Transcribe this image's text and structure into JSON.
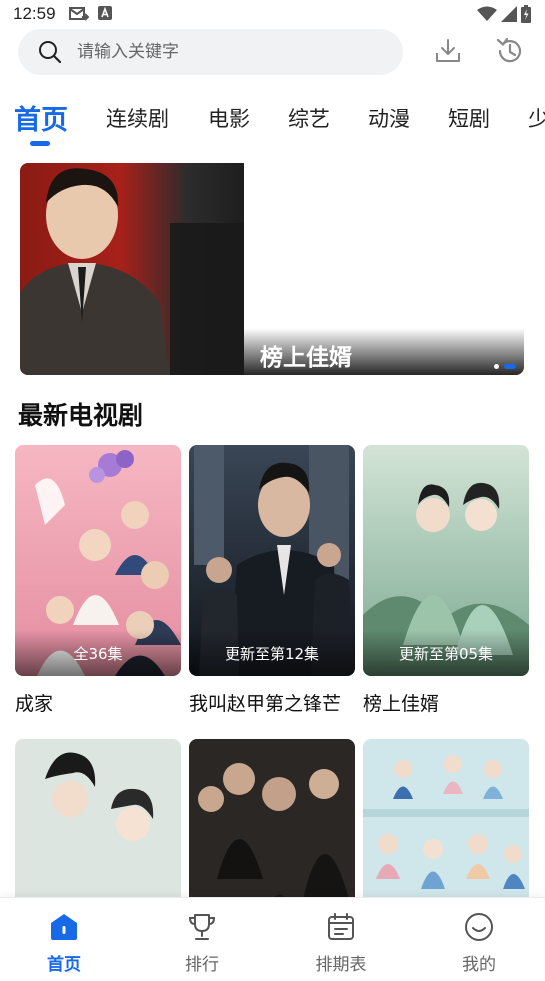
{
  "status_bar": {
    "time": "12:59",
    "left_icons": [
      "mail-forward-icon",
      "a-box-icon"
    ],
    "right_icons": [
      "wifi-icon",
      "signal-icon",
      "battery-icon"
    ]
  },
  "search": {
    "placeholder": "请输入关键字"
  },
  "header_icons": [
    "download-icon",
    "history-icon"
  ],
  "tabs": [
    {
      "label": "首页",
      "active": true
    },
    {
      "label": "连续剧",
      "active": false
    },
    {
      "label": "电影",
      "active": false
    },
    {
      "label": "综艺",
      "active": false
    },
    {
      "label": "动漫",
      "active": false
    },
    {
      "label": "短剧",
      "active": false
    },
    {
      "label": "少",
      "active": false
    }
  ],
  "banner": {
    "title": "榜上佳婿",
    "dots": 2,
    "active_dot": 1
  },
  "section": {
    "title": "最新电视剧"
  },
  "shows": [
    {
      "title": "成家",
      "badge": "全36集",
      "colors": [
        "#f4a7b4",
        "#e88ea2"
      ]
    },
    {
      "title": "我叫赵甲第之锋芒",
      "badge": "更新至第12集",
      "colors": [
        "#2b3644",
        "#151b24"
      ]
    },
    {
      "title": "榜上佳婿",
      "badge": "更新至第05集",
      "colors": [
        "#b9d3c0",
        "#6f9f86"
      ]
    },
    {
      "title": "",
      "badge": "",
      "colors": [
        "#dfe6e2",
        "#c9d6cf"
      ]
    },
    {
      "title": "",
      "badge": "",
      "colors": [
        "#3a3633",
        "#1e1b19"
      ]
    },
    {
      "title": "",
      "badge": "",
      "colors": [
        "#cfe8ec",
        "#9ccfd6"
      ]
    }
  ],
  "bottom_nav": [
    {
      "label": "首页",
      "icon": "home-icon",
      "active": true
    },
    {
      "label": "排行",
      "icon": "trophy-icon",
      "active": false
    },
    {
      "label": "排期表",
      "icon": "calendar-icon",
      "active": false
    },
    {
      "label": "我的",
      "icon": "smiley-icon",
      "active": false
    }
  ],
  "colors": {
    "accent": "#1769e8",
    "text": "#111111",
    "muted": "#666666",
    "search_bg": "#f1f2f4"
  }
}
